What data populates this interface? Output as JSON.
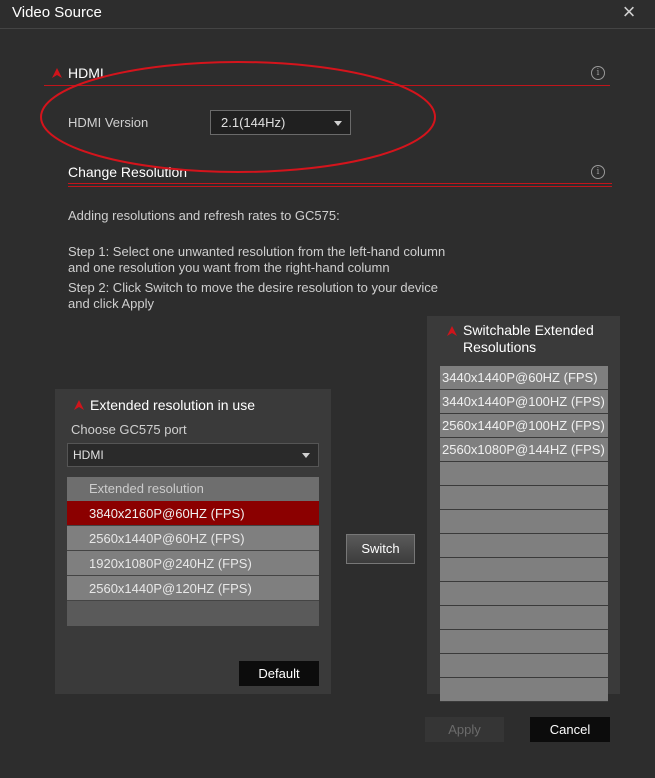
{
  "window": {
    "title": "Video Source"
  },
  "hdmi_section": {
    "title": "HDMI",
    "version_label": "HDMI Version",
    "version_value": "2.1(144Hz)"
  },
  "resolution_section": {
    "title": "Change Resolution",
    "intro": "Adding resolutions and refresh rates to GC575:",
    "step1_line1": "Step 1: Select one unwanted resolution from the left-hand column",
    "step1_line2": "and one resolution you want from the right-hand column",
    "step2_line1": "Step 2: Click Switch to move the desire resolution to your device",
    "step2_line2": "and click Apply"
  },
  "left_panel": {
    "title": "Extended resolution in use",
    "port_label": "Choose GC575 port",
    "port_value": "HDMI",
    "list_header": "Extended resolution",
    "items": [
      "3840x2160P@60HZ (FPS)",
      "2560x1440P@60HZ (FPS)",
      "1920x1080P@240HZ (FPS)",
      "2560x1440P@120HZ (FPS)"
    ],
    "selected_index": 0,
    "default_button": "Default"
  },
  "switch_button": "Switch",
  "right_panel": {
    "title_line1": "Switchable Extended",
    "title_line2": "Resolutions",
    "items": [
      "3440x1440P@60HZ (FPS)",
      "3440x1440P@100HZ (FPS)",
      "2560x1440P@100HZ (FPS)",
      "2560x1080P@144HZ (FPS)",
      "",
      "",
      "",
      "",
      "",
      "",
      "",
      "",
      "",
      ""
    ]
  },
  "footer": {
    "apply": "Apply",
    "cancel": "Cancel"
  },
  "colors": {
    "accent_red": "#c0151b",
    "selected_row": "#8b0000",
    "annotation_ellipse": "#d4141c"
  }
}
